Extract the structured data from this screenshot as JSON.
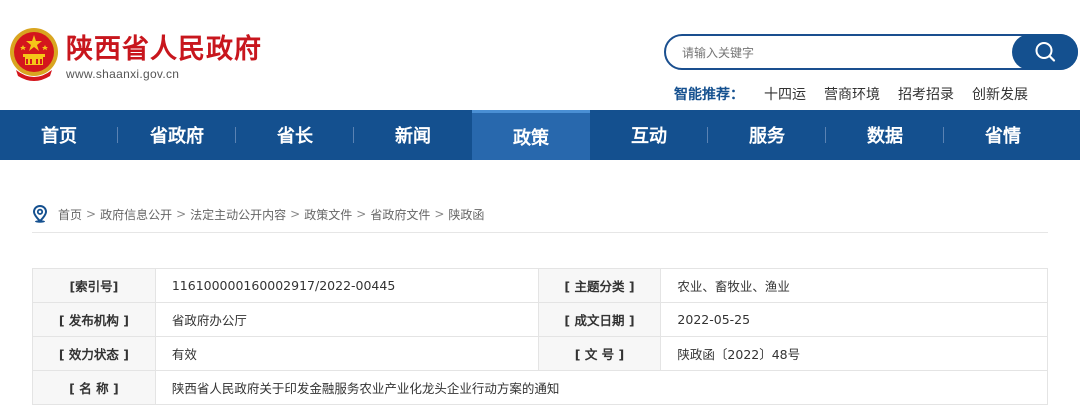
{
  "header": {
    "site_title": "陕西省人民政府",
    "site_url": "www.shaanxi.gov.cn",
    "search_placeholder": "请输入关键字",
    "recommend_label": "智能推荐：",
    "recommend_items": [
      "十四运",
      "营商环境",
      "招考招录",
      "创新发展"
    ]
  },
  "nav": {
    "items": [
      "首页",
      "省政府",
      "省长",
      "新闻",
      "政策",
      "互动",
      "服务",
      "数据",
      "省情"
    ],
    "active": "政策"
  },
  "breadcrumb": {
    "items": [
      "首页",
      "政府信息公开",
      "法定主动公开内容",
      "政策文件",
      "省政府文件",
      "陕政函"
    ],
    "separator": ">"
  },
  "info": {
    "index_label": "[索引号]",
    "index_value": "116100000160002917/2022-00445",
    "topic_label": "[ 主题分类 ]",
    "topic_value": "农业、畜牧业、渔业",
    "org_label": "[ 发布机构 ]",
    "org_value": "省政府办公厅",
    "date_label": "[ 成文日期 ]",
    "date_value": "2022-05-25",
    "status_label": "[ 效力状态 ]",
    "status_value": "有效",
    "docno_label": "[ 文 号 ]",
    "docno_value": "陕政函〔2022〕48号",
    "name_label": "[ 名 称 ]",
    "name_value": "陕西省人民政府关于印发金融服务农业产业化龙头企业行动方案的通知"
  },
  "colors": {
    "brand_red": "#c8161d",
    "nav_blue": "#14508f",
    "nav_active": "#2868ad"
  }
}
